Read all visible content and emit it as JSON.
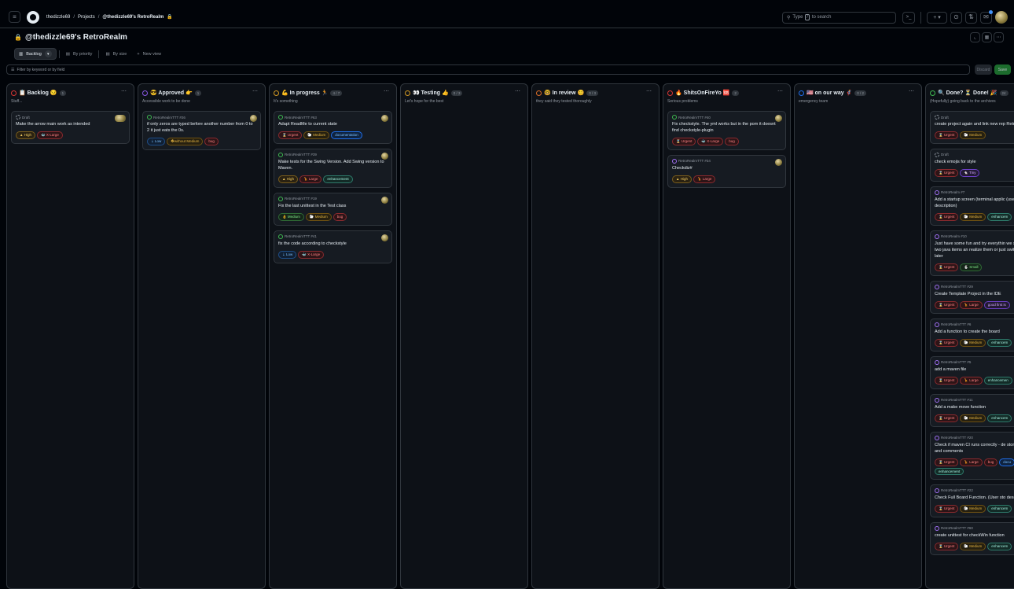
{
  "topbar": {
    "menu_icon": "hamburger-icon",
    "crumbs": [
      "thedizzle69",
      "Projects",
      "@thedizzle69's RetroRealm"
    ],
    "search_placeholder_pre": "Type",
    "search_kbd": "/",
    "search_placeholder_post": "to search",
    "command_glyph": ">_",
    "plus_glyph": "+ ▾"
  },
  "header": {
    "title": "@thedizzle69's RetroRealm"
  },
  "tabs": [
    {
      "label": "Backlog"
    },
    {
      "label": "By priority"
    },
    {
      "label": "By size"
    },
    {
      "label": "New view"
    }
  ],
  "filter": {
    "placeholder": "Filter by keyword or by field",
    "discard": "Discard",
    "save": "Save"
  },
  "columns": [
    {
      "title": "📋 Backlog 😏",
      "ring_color": "#da3633",
      "count": "1",
      "desc": "Stuff...",
      "cards": [
        {
          "ref": "Draft",
          "kind": "draft",
          "title": "Make the arrow main work as intended",
          "labels": [
            [
              "▲ High",
              "l-high"
            ],
            [
              "🐳 X-Large",
              "l-xlarge"
            ]
          ],
          "avatar": "wide"
        }
      ]
    },
    {
      "title": "😎 Approved 👉",
      "ring_color": "#8957e5",
      "count": "1",
      "desc": "Accessible work to be done",
      "cards": [
        {
          "ref": "RetroRealmTTT #26",
          "kind": "open",
          "title": "if only zeros are typed before another number from 0 to 2 it just eats the 0s.",
          "labels": [
            [
              "⇣ Low",
              "l-low"
            ],
            [
              "�without Medium",
              "l-medium"
            ],
            [
              "bug",
              "l-bug"
            ]
          ],
          "avatar": "round"
        }
      ]
    },
    {
      "title": "💪 In progress 🏃",
      "ring_color": "#d29922",
      "count": "4 / 7",
      "desc": "It's something",
      "cards": [
        {
          "ref": "RetroRealmTTT #63",
          "kind": "open",
          "title": "Adapt ReadMe to current state",
          "labels": [
            [
              "⌛ Urgent",
              "l-urgent"
            ],
            [
              "🐑 Medium",
              "l-medium"
            ],
            [
              "documentation",
              "l-doc"
            ]
          ],
          "avatar": "round"
        },
        {
          "ref": "RetroRealmTTT #39",
          "kind": "open",
          "title": "Make tests for the Swing Version. Add Swing version to Maven.",
          "labels": [
            [
              "▲ High",
              "l-high"
            ],
            [
              "🦒 Large",
              "l-large"
            ],
            [
              "enhancement",
              "l-enh"
            ]
          ],
          "avatar": "round"
        },
        {
          "ref": "RetroRealmTTT #19",
          "kind": "open",
          "title": "Fix the last unittest in the Test class",
          "labels": [
            [
              "👌 Medium",
              "l-medium-g"
            ],
            [
              "🐑 Medium",
              "l-medium"
            ],
            [
              "bug",
              "l-bug"
            ]
          ],
          "avatar": "round"
        },
        {
          "ref": "RetroRealmTTT #41",
          "kind": "open",
          "title": "fix the code according to checkstyle",
          "labels": [
            [
              "⇣ Low",
              "l-low"
            ],
            [
              "🐳 X-Large",
              "l-xlarge"
            ]
          ],
          "avatar": "round"
        }
      ]
    },
    {
      "title": "👀 Testing 👍",
      "ring_color": "#d29922",
      "count": "0 / 3",
      "desc": "Let's hope for the best",
      "cards": []
    },
    {
      "title": "🤓 In review 😊",
      "ring_color": "#db6d28",
      "count": "0 / 3",
      "desc": "they said they tested thoroughly",
      "cards": []
    },
    {
      "title": "🔥 ShitsOnFireYo 🆘",
      "ring_color": "#da3633",
      "count": "2",
      "desc": "Serious problems",
      "cards": [
        {
          "ref": "RetroRealmTTT #40",
          "kind": "open",
          "title": "Fix checkstyle. The yml works but in the pom it doesnt find checkstyle-plugin",
          "labels": [
            [
              "⌛ Urgent",
              "l-urgent"
            ],
            [
              "🐳 X-Large",
              "l-xlarge"
            ],
            [
              "bug",
              "l-bug"
            ]
          ],
          "avatar": "round"
        },
        {
          "ref": "RetroRealmTTT #34",
          "kind": "done",
          "title": "Checkdiz#",
          "labels": [
            [
              "▲ High",
              "l-high"
            ],
            [
              "🦒 Large",
              "l-large"
            ]
          ],
          "avatar": "round"
        }
      ]
    },
    {
      "title": "🇺🇸 on our way 🦸",
      "ring_color": "#1f6feb",
      "count": "0 / 2",
      "desc": "emergency team",
      "cards": []
    },
    {
      "title": "🔍 Done? ⏳ Done! 🎉",
      "ring_color": "#3fb950",
      "count": "24",
      "desc": "(Hopefully) going back to the archives",
      "cards": [
        {
          "ref": "Draft",
          "kind": "draft",
          "title": "create project again and link new rep RetroRealm",
          "labels": [
            [
              "⌛ Urgent",
              "l-urgent"
            ],
            [
              "🐑 Medium",
              "l-medium"
            ]
          ],
          "avatar": "none"
        },
        {
          "ref": "Draft",
          "kind": "draft",
          "title": "check emojis for style",
          "labels": [
            [
              "⌛ Urgent",
              "l-urgent"
            ],
            [
              "🐁 Tiny",
              "l-tiny"
            ]
          ],
          "avatar": "none"
        },
        {
          "ref": "RetroRealm #7",
          "kind": "done",
          "title": "Add a startup screen (terminal applic (user story in description)",
          "labels": [
            [
              "⌛ Urgent",
              "l-urgent"
            ],
            [
              "🐑 Medium",
              "l-medium"
            ],
            [
              "enhancem",
              "l-enh"
            ]
          ],
          "avatar": "none"
        },
        {
          "ref": "RetroRealm #10",
          "kind": "done",
          "title": "Just have some fun and try everythin we still keep those two java items an realize them or just switch to another later",
          "labels": [
            [
              "⌛ Urgent",
              "l-urgent"
            ],
            [
              "🐇 Small",
              "l-small"
            ]
          ],
          "avatar": "none"
        },
        {
          "ref": "RetroRealmTTT #29",
          "kind": "done",
          "title": "Create Template Project in the IDE",
          "labels": [
            [
              "⌛ Urgent",
              "l-urgent"
            ],
            [
              "🦒 Large",
              "l-large"
            ],
            [
              "good first is",
              "l-gfi"
            ]
          ],
          "avatar": "none"
        },
        {
          "ref": "RetroRealmTTT #6",
          "kind": "done",
          "title": "Add a function to create the board",
          "labels": [
            [
              "⌛ Urgent",
              "l-urgent"
            ],
            [
              "🐑 Medium",
              "l-medium"
            ],
            [
              "enhancem",
              "l-enh"
            ]
          ],
          "avatar": "none"
        },
        {
          "ref": "RetroRealmTTT #5",
          "kind": "done",
          "title": "add a maven file",
          "labels": [
            [
              "⌛ Urgent",
              "l-urgent"
            ],
            [
              "🦒 Large",
              "l-large"
            ],
            [
              "enhancemen",
              "l-enh"
            ]
          ],
          "avatar": "none"
        },
        {
          "ref": "RetroRealmTTT #11",
          "kind": "done",
          "title": "Add a make move function",
          "labels": [
            [
              "⌛ Urgent",
              "l-urgent"
            ],
            [
              "🐑 Medium",
              "l-medium"
            ],
            [
              "enhancem",
              "l-enh"
            ]
          ],
          "avatar": "none"
        },
        {
          "ref": "RetroRealmTTT #20",
          "kind": "done",
          "title": "Check if maven CI runs correctly - de story in description and comments",
          "labels": [
            [
              "⌛ Urgent",
              "l-urgent"
            ],
            [
              "🦒 Large",
              "l-large"
            ],
            [
              "bug",
              "l-bug"
            ],
            [
              "docu",
              "l-doc"
            ],
            [
              "enhancement",
              "l-enh"
            ]
          ],
          "avatar": "none"
        },
        {
          "ref": "RetroRealmTTT #22",
          "kind": "done",
          "title": "Check Full Board Function. (User sto description)",
          "labels": [
            [
              "⌛ Urgent",
              "l-urgent"
            ],
            [
              "🐑 Medium",
              "l-medium"
            ],
            [
              "enhancem",
              "l-enh"
            ]
          ],
          "avatar": "none"
        },
        {
          "ref": "RetroRealmTTT #60",
          "kind": "done",
          "title": "create unittest for checkWin function",
          "labels": [
            [
              "⌛ Urgent",
              "l-urgent"
            ],
            [
              "🐑 Medium",
              "l-medium"
            ],
            [
              "enhancem",
              "l-enh"
            ]
          ],
          "avatar": "none"
        }
      ]
    }
  ]
}
